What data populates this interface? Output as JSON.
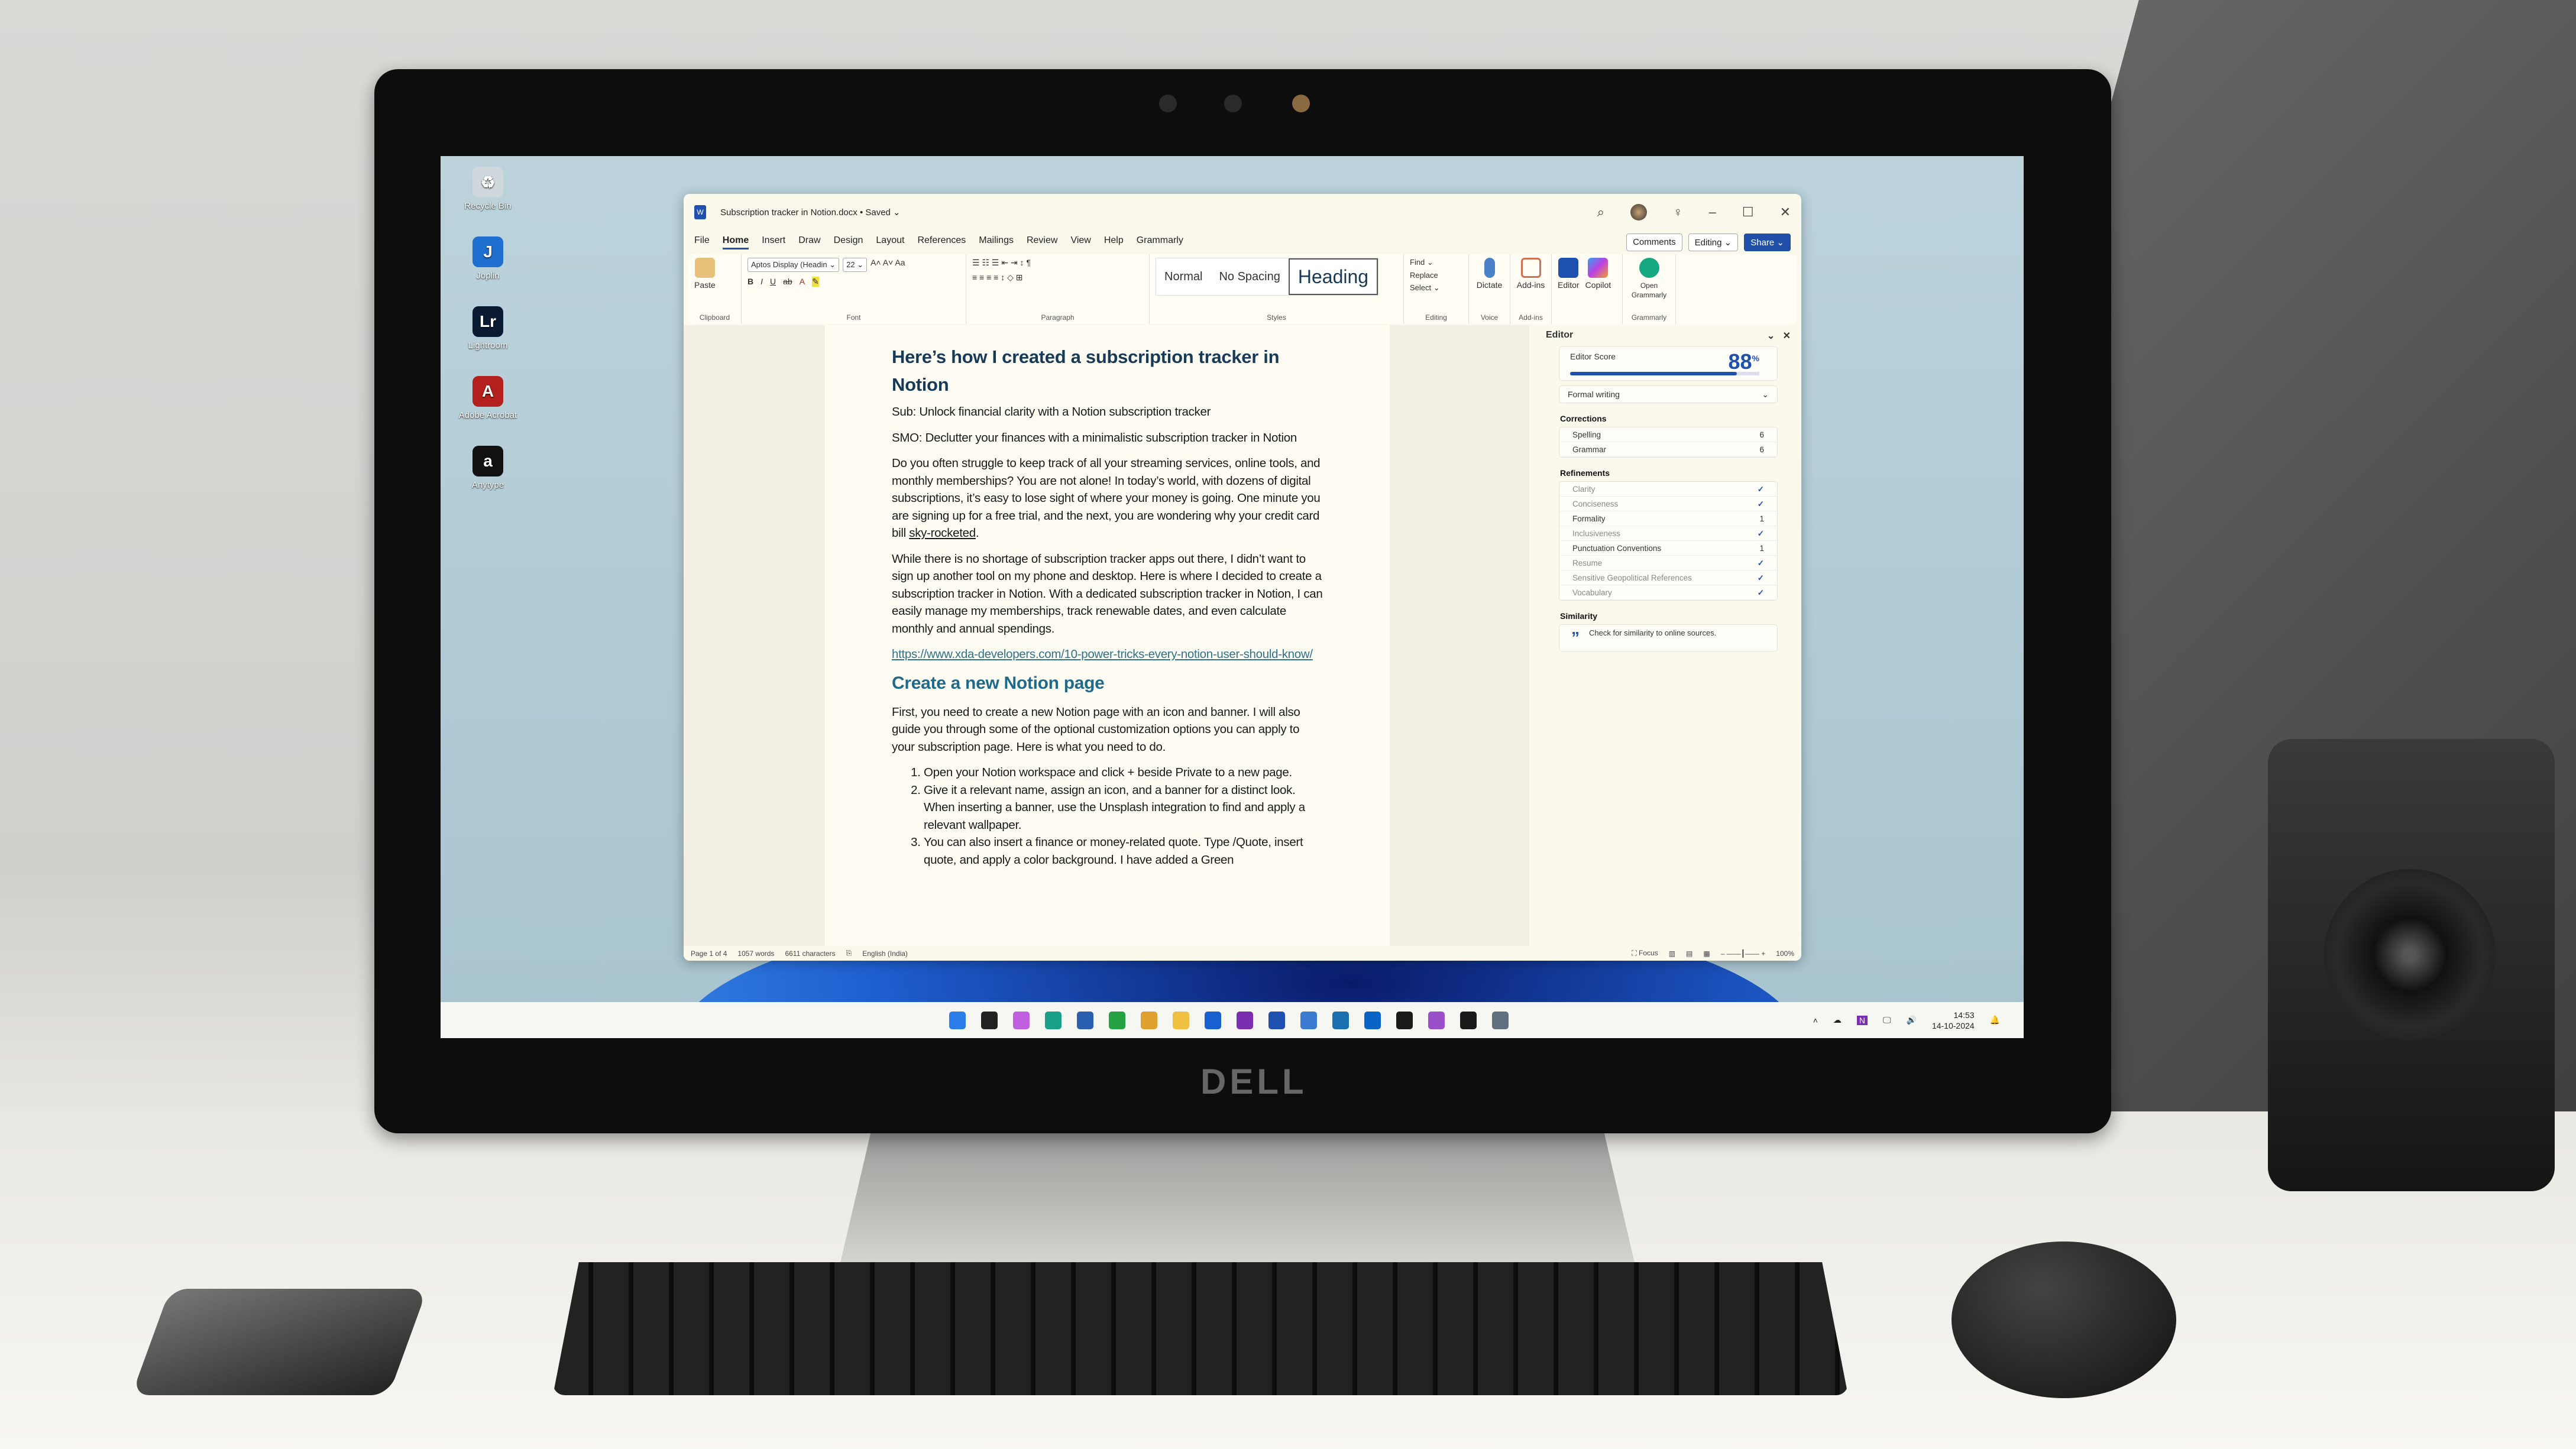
{
  "desktop": {
    "icons": [
      {
        "label": "Recycle Bin",
        "icon": "recycle-bin-icon",
        "color": "#cfd8dc"
      },
      {
        "label": "Joplin",
        "icon": "joplin-icon",
        "color": "#1f6fd0",
        "glyph": "J"
      },
      {
        "label": "Lightroom",
        "icon": "lightroom-icon",
        "color": "#0a1a33",
        "glyph": "Lr"
      },
      {
        "label": "Adobe Acrobat",
        "icon": "acrobat-icon",
        "color": "#b3201d",
        "glyph": "A"
      },
      {
        "label": "Anytype",
        "icon": "anytype-icon",
        "color": "#111111",
        "glyph": "a"
      }
    ]
  },
  "window": {
    "title": "Subscription tracker in Notion.docx • Saved ⌄",
    "app_glyph": "W",
    "tabs": [
      "File",
      "Home",
      "Insert",
      "Draw",
      "Design",
      "Layout",
      "References",
      "Mailings",
      "Review",
      "View",
      "Help",
      "Grammarly"
    ],
    "active_tab": "Home",
    "buttons": {
      "comments": "Comments",
      "editing": "Editing ⌄",
      "share": "Share ⌄"
    },
    "ribbon": {
      "paste": "Paste",
      "clipboard": "Clipboard",
      "font_name": "Aptos Display (Headin ⌄",
      "font_size": "22 ⌄",
      "font": "Font",
      "paragraph": "Paragraph",
      "styles_label": "Styles",
      "styles": [
        "Normal",
        "No Spacing",
        "Heading"
      ],
      "find": "Find ⌄",
      "replace": "Replace",
      "select": "Select ⌄",
      "editing": "Editing",
      "dictate": "Dictate",
      "voice": "Voice",
      "addins": "Add-ins",
      "addins_group": "Add-ins",
      "editor": "Editor",
      "copilot": "Copilot",
      "open_grammarly": "Open Grammarly",
      "grammarly": "Grammarly"
    },
    "accent": "#1f4fa8"
  },
  "document": {
    "title": "Here’s how I created a subscription tracker in Notion",
    "sub": "Sub: Unlock financial clarity with a Notion subscription tracker",
    "smo": "SMO: Declutter your finances with a minimalistic subscription tracker in Notion",
    "p1_before": "Do you often struggle to keep track of all your streaming services, online tools, and monthly memberships? You are not alone! In today’s world, with dozens of digital subscriptions, it’s easy to lose sight of where your money is going. One minute you are signing up for a free trial, and the next, you are wondering why your credit card bill ",
    "p1_link": "sky-rocketed",
    "p1_after": ".",
    "p2": "While there is no shortage of subscription tracker apps out there, I didn’t want to sign up another tool on my phone and desktop. Here is where I decided to create a subscription tracker in Notion. With a dedicated subscription tracker in Notion, I can easily manage my memberships, track renewable dates, and even calculate monthly and annual spendings.",
    "url": "https://www.xda-developers.com/10-power-tricks-every-notion-user-should-know/",
    "h2": "Create a new Notion page",
    "p3": "First, you need to create a new Notion page with an icon and banner. I will also guide you through some of the optional customization options you can apply to your subscription page. Here is what you need to do.",
    "steps": [
      "Open your Notion workspace and click + beside Private to a new page.",
      "Give it a relevant name, assign an icon, and a banner for a distinct look. When inserting a banner, use the Unsplash integration to find and apply a relevant wallpaper.",
      "You can also insert a finance or money-related quote. Type /Quote, insert quote, and apply a color background. I have added a Green"
    ]
  },
  "editor": {
    "title": "Editor",
    "score_label": "Editor Score",
    "score": "88",
    "score_unit": "%",
    "score_fraction": 0.88,
    "mode": "Formal writing",
    "corrections_label": "Corrections",
    "corrections": [
      {
        "label": "Spelling",
        "count": "6"
      },
      {
        "label": "Grammar",
        "count": "6"
      }
    ],
    "refinements_label": "Refinements",
    "refinements": [
      {
        "label": "Clarity",
        "count": "✓",
        "done": true
      },
      {
        "label": "Conciseness",
        "count": "✓",
        "done": true
      },
      {
        "label": "Formality",
        "count": "1",
        "done": false
      },
      {
        "label": "Inclusiveness",
        "count": "✓",
        "done": true
      },
      {
        "label": "Punctuation Conventions",
        "count": "1",
        "done": false
      },
      {
        "label": "Resume",
        "count": "✓",
        "done": true
      },
      {
        "label": "Sensitive Geopolitical References",
        "count": "✓",
        "done": true
      },
      {
        "label": "Vocabulary",
        "count": "✓",
        "done": true
      }
    ],
    "similarity_label": "Similarity",
    "similarity_text": "Check for similarity to online sources."
  },
  "status": {
    "page": "Page 1 of 4",
    "words": "1057 words",
    "chars": "6611 characters",
    "language": "English (India)",
    "focus": "Focus",
    "zoom": "100%"
  },
  "taskbar": {
    "apps": [
      {
        "icon": "windows-start-icon",
        "color": "#2b7de9"
      },
      {
        "icon": "terminal-icon",
        "color": "#222"
      },
      {
        "icon": "copilot-icon",
        "color": "#c060e0"
      },
      {
        "icon": "edge-icon",
        "color": "#1a9f8a"
      },
      {
        "icon": "store-icon",
        "color": "#2a5fb0"
      },
      {
        "icon": "whatsapp-icon",
        "color": "#25a244"
      },
      {
        "icon": "slack-icon",
        "color": "#e0a030"
      },
      {
        "icon": "file-explorer-icon",
        "color": "#f0c040"
      },
      {
        "icon": "1password-icon",
        "color": "#1a5fd0"
      },
      {
        "icon": "onenote-icon",
        "color": "#7a2fb0"
      },
      {
        "icon": "word-icon",
        "color": "#1e50b0"
      },
      {
        "icon": "photos-icon",
        "color": "#3a7ad0"
      },
      {
        "icon": "steam-icon",
        "color": "#1a6fb0"
      },
      {
        "icon": "outlook-icon",
        "color": "#0a64c8"
      },
      {
        "icon": "figma-icon",
        "color": "#1a1a1a"
      },
      {
        "icon": "app-icon",
        "color": "#9a50c8"
      },
      {
        "icon": "davinci-icon",
        "color": "#1a1a1a"
      },
      {
        "icon": "settings-icon",
        "color": "#607080"
      }
    ],
    "time": "14:53",
    "date": "14-10-2024"
  }
}
